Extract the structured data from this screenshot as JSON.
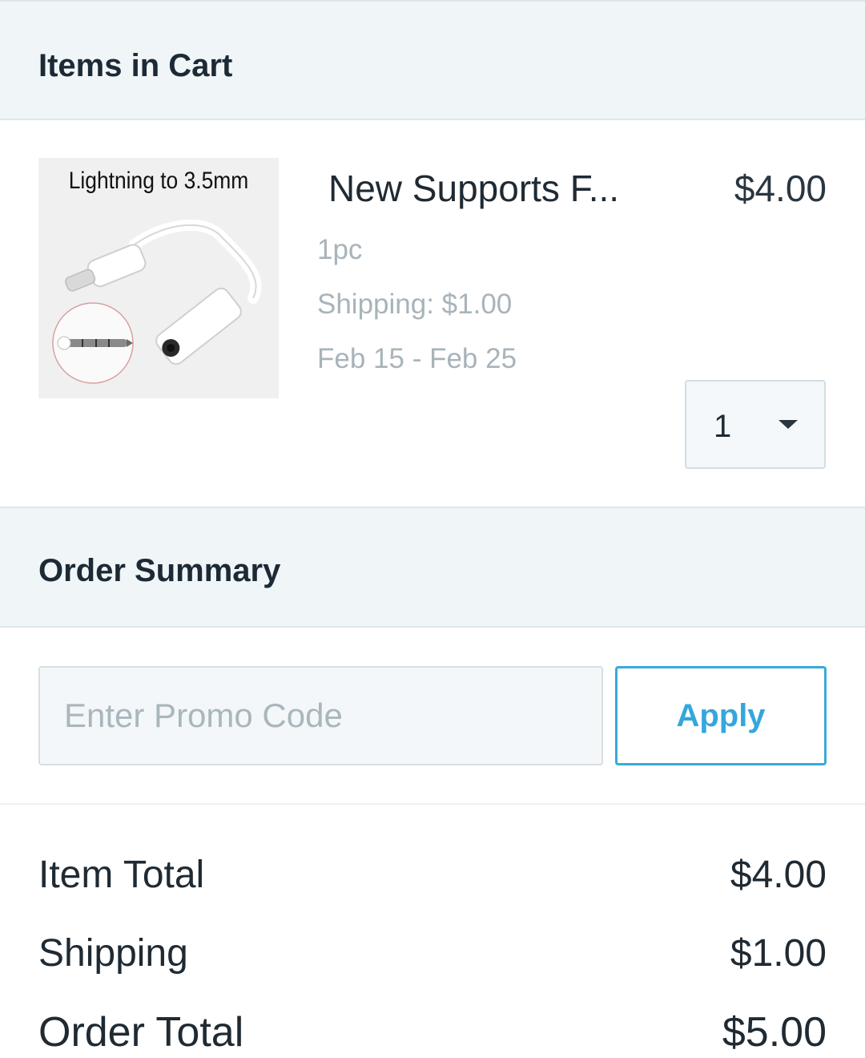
{
  "cart": {
    "header": "Items in Cart",
    "item": {
      "image_caption": "Lightning to 3.5mm",
      "name": "New Supports F...",
      "price": "$4.00",
      "quantity_unit": "1pc",
      "shipping": "Shipping: $1.00",
      "delivery": "Feb 15 - Feb 25",
      "quantity": "1"
    }
  },
  "summary": {
    "header": "Order Summary",
    "promo_placeholder": "Enter Promo Code",
    "apply_label": "Apply",
    "rows": [
      {
        "label": "Item Total",
        "value": "$4.00"
      },
      {
        "label": "Shipping",
        "value": "$1.00"
      },
      {
        "label": "Order Total",
        "value": "$5.00"
      }
    ]
  },
  "colors": {
    "header_bg": "#f0f5f8",
    "accent": "#34a7dc",
    "muted_text": "#a8b4ba"
  }
}
